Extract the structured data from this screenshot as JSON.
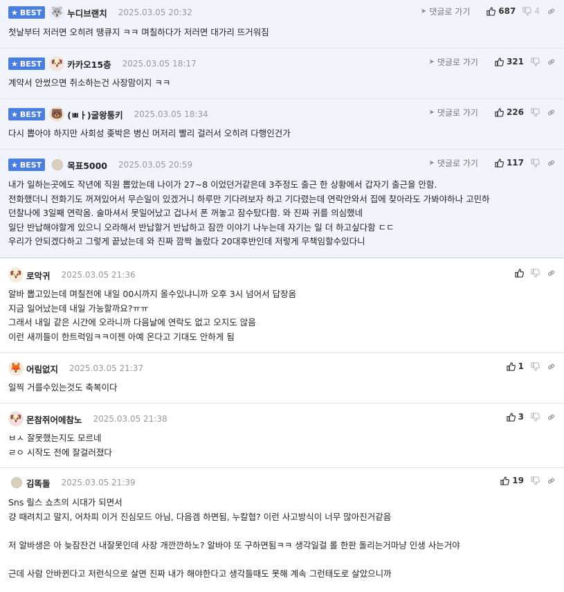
{
  "badge_label": "BEST",
  "goto_label": "댓글로 가기",
  "comments": [
    {
      "nick": "누디브랜치",
      "date": "2025.03.05 20:32",
      "likes": "687",
      "dislikes": "4",
      "lines": [
        "첫날부터 저러면 오히려 땡큐지 ㅋㅋ 며칠하다가 저러면 대가리 뜨거워짐"
      ]
    },
    {
      "nick": "카카오15층",
      "date": "2025.03.05 18:17",
      "likes": "321",
      "lines": [
        "계약서 안썼으면 취소하는건 사장맘이지 ㅋㅋ"
      ]
    },
    {
      "nick": "(ㅃㅏ)굴왕통키",
      "date": "2025.03.05 18:34",
      "likes": "226",
      "lines": [
        "다시 뽑아야 하지만 사회성 좆박은 병신 머저리 빨리 걸러서 오히려 다행인건가"
      ]
    },
    {
      "nick": "목표5000",
      "date": "2025.03.05 20:59",
      "likes": "117",
      "lines": [
        "내가 일하는곳에도 작년에 직원 뽑았는데 나이가 27~8 이었던거같은데 3주정도 출근 한 상황에서 갑자기 출근을 안함.",
        "전화했더니 전화기도 꺼져있어서 무슨일이 있겠거니 하루만 기다려보자 하고 기다렸는데 연락안와서 집에 찾아라도 가봐야하나 고민하",
        "던찰나에 3일째 연락옴. 술마셔서 못일어났고 겁나서 폰 꺼놓고 잠수탔다함. 와 진짜 귀를 의심했네",
        "일단 반납해야할게 있으니 오라해서 반납할거 반납하고 잠깐 이야기 나누는데 자기는 일 더 하고싶다함 ㄷㄷ",
        "우리가 안되겠다하고 그렇게 끝났는데 와 진짜 깜짝 놀랐다 20대후반인데 저렇게 무책임할수있다니"
      ]
    },
    {
      "nick": "로악귀",
      "date": "2025.03.05 21:36",
      "likes": "",
      "lines": [
        "알바 뽑고있는데 며칠전에 내일 00시까지 올수있냐니까 오후 3시 넘어서 답장옴",
        "지금 일어났는데 내일 가능할까요?ㅠㅠ",
        "그래서 내일 같은 시간에 오라니까 다음날에 연락도 없고 오지도 않음",
        "이런 새끼들이 한트럭임ㅋㅋ이젠 아예 온다고 기대도 안하게 됨"
      ]
    },
    {
      "nick": "어림없지",
      "date": "2025.03.05 21:37",
      "likes": "1",
      "lines": [
        "일찍 거를수있는것도 축복이다"
      ]
    },
    {
      "nick": "몬참쥐어에참노",
      "date": "2025.03.05 21:38",
      "likes": "3",
      "lines": [
        "ㅂㅅ 잘못했는지도 모르네",
        "ㄹㅇ 시작도 전에 잘걸러졌다"
      ]
    },
    {
      "nick": "김똑돌",
      "date": "2025.03.05 21:39",
      "likes": "19",
      "lines": [
        "Sns 릴스 쇼츠의 시대가 되면서",
        "걍 때려치고 말지, 어차피 이거 진심모드 아님, 다음겜 하면됨, 누칼협? 이런 사고방식이 너무 많아진거같음",
        "",
        "저 알바생은 아 늦잠잔건 내잘못인데 사장 개깐깐하노? 알바야 또 구하면됨ㅋㅋ 생각일걸 롤 한판 돌리는거마냥 인생 사는거야",
        "",
        "근데 사람 안바뀐다고 저런식으로 살면 진짜 내가 해야한다고 생각들때도 못해 계속 그런태도로 살았으니까"
      ]
    }
  ]
}
